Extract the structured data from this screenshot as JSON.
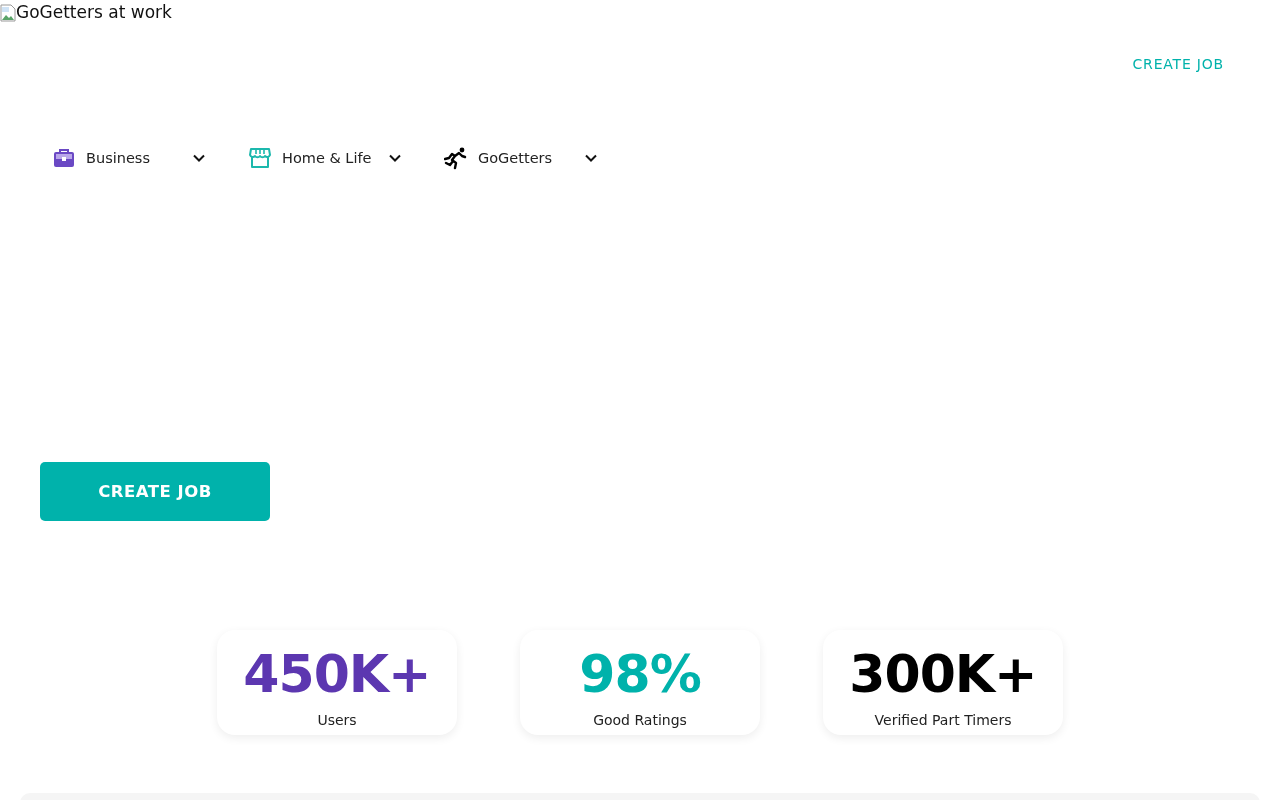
{
  "hero_image": {
    "alt": "GoGetters at work"
  },
  "header": {
    "create_job_link": "CREATE JOB"
  },
  "nav": [
    {
      "label": "Business",
      "kind": "briefcase"
    },
    {
      "label": "Home & Life",
      "kind": "store"
    },
    {
      "label": "GoGetters",
      "kind": "runner"
    }
  ],
  "cta_button": "CREATE JOB",
  "stats": [
    {
      "value": "450K+",
      "label": "Users",
      "color": "#5c37b0"
    },
    {
      "value": "98%",
      "label": "Good Ratings",
      "color": "#00b2ab"
    },
    {
      "value": "300K+",
      "label": "Verified Part Timers",
      "color": "#000000"
    }
  ]
}
